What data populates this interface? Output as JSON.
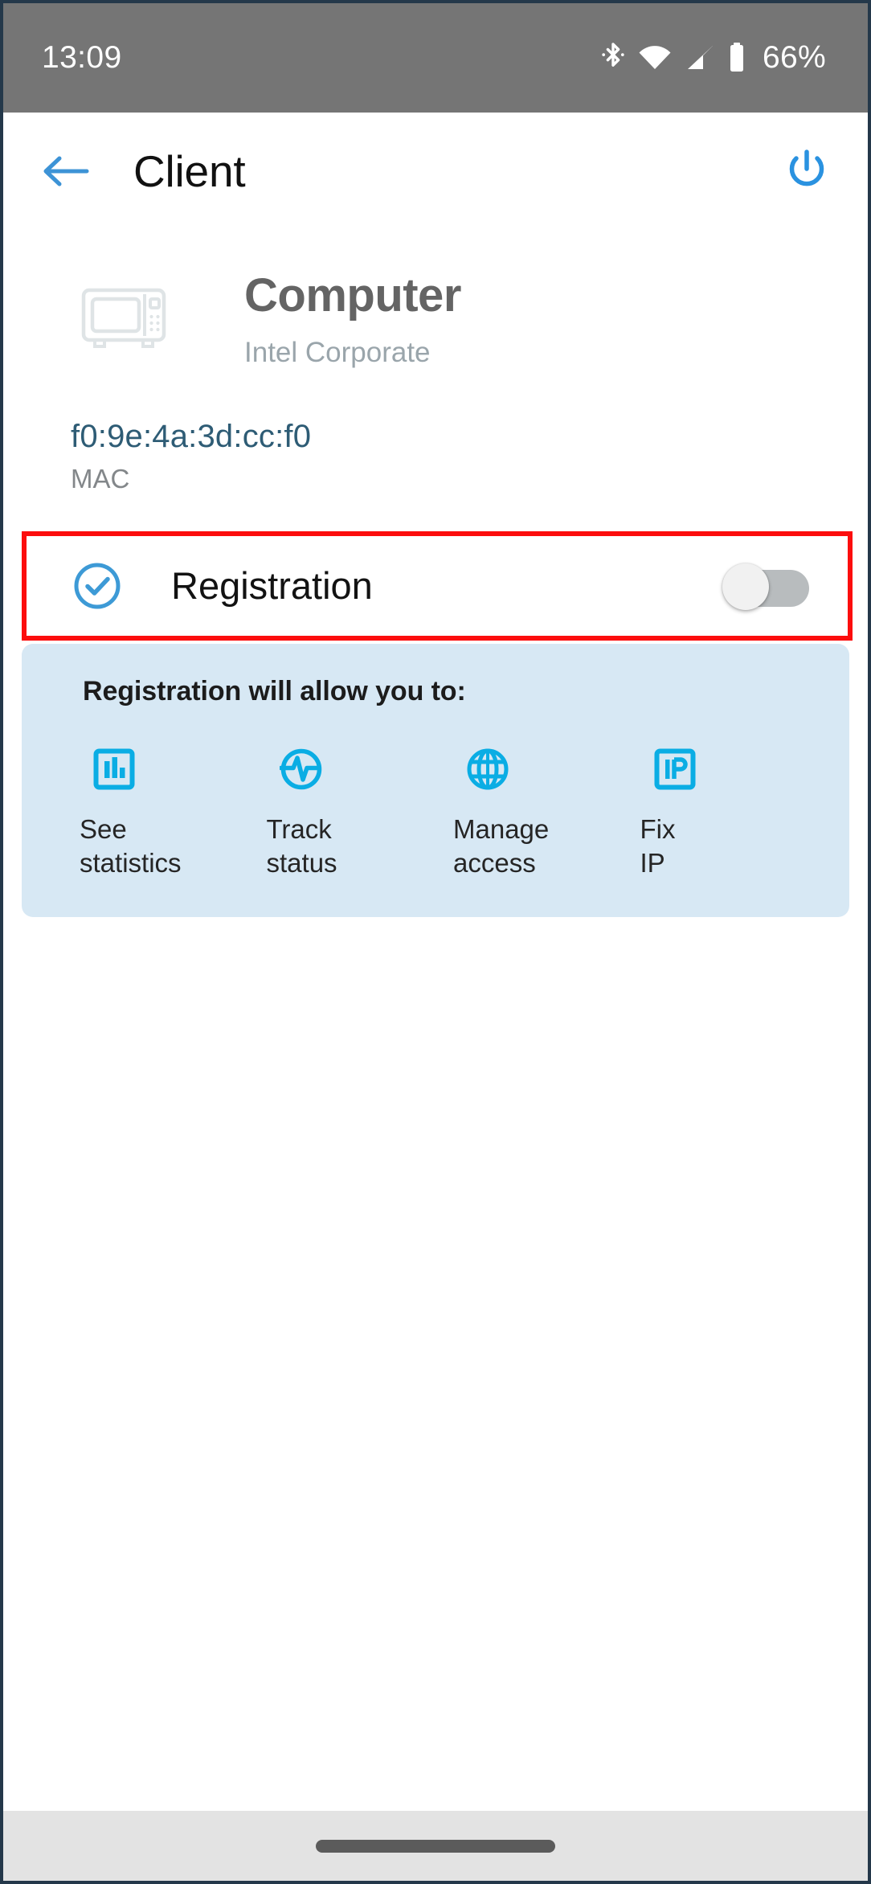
{
  "status_bar": {
    "clock": "13:09",
    "battery_percent": "66%",
    "icons": [
      "bluetooth-icon",
      "wifi-icon",
      "cellular-signal-icon",
      "battery-icon"
    ],
    "background_color": "#757575",
    "foreground_color": "#ffffff"
  },
  "app_bar": {
    "back_label": "back-arrow-icon",
    "title": "Client",
    "power_label": "power-icon",
    "accent_color": "#3d93d6"
  },
  "device": {
    "icon": "computer-monitor-icon",
    "name": "Computer",
    "vendor": "Intel Corporate"
  },
  "mac": {
    "value": "f0:9e:4a:3d:cc:f0",
    "label": "MAC",
    "value_color": "#2e5c75"
  },
  "registration": {
    "label": "Registration",
    "check_icon": "check-circle-icon",
    "toggle_state": "off",
    "highlight_color": "#fc0d0d"
  },
  "info_panel": {
    "title": "Registration will allow you to:",
    "background_color": "#d7e8f4",
    "icon_color": "#0aade4",
    "features": [
      {
        "icon": "bar-chart-icon",
        "line1": "See",
        "line2": "statistics"
      },
      {
        "icon": "pulse-circle-icon",
        "line1": "Track",
        "line2": "status"
      },
      {
        "icon": "globe-icon",
        "line1": "Manage",
        "line2": "access"
      },
      {
        "icon": "ip-box-icon",
        "line1": "Fix",
        "line2": "IP"
      }
    ]
  },
  "nav_bar": {
    "gesture_pill": "home-gesture-pill",
    "background_color": "#e3e3e3"
  }
}
